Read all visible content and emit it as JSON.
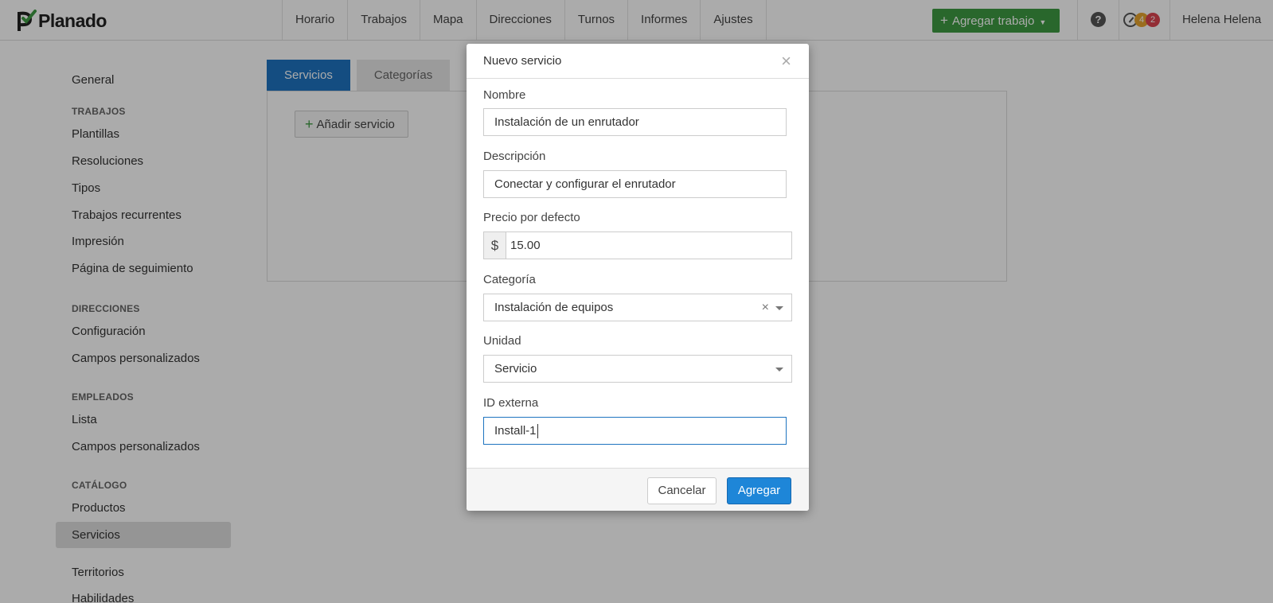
{
  "app": {
    "logo_text": "Planado",
    "nav": [
      "Horario",
      "Trabajos",
      "Mapa",
      "Direcciones",
      "Turnos",
      "Informes",
      "Ajustes"
    ],
    "add_job_label": "Agregar trabajo",
    "help_symbol": "?",
    "badge_orange": "4",
    "badge_red": "2",
    "user_name": "Helena Helena"
  },
  "sidebar": {
    "general": "General",
    "sections": [
      {
        "heading": "TRABAJOS",
        "items": [
          "Plantillas",
          "Resoluciones",
          "Tipos",
          "Trabajos recurrentes",
          "Impresión",
          "Página de seguimiento"
        ]
      },
      {
        "heading": "DIRECCIONES",
        "items": [
          "Configuración",
          "Campos personalizados"
        ]
      },
      {
        "heading": "EMPLEADOS",
        "items": [
          "Lista",
          "Campos personalizados"
        ]
      },
      {
        "heading": "CATÁLOGO",
        "items": [
          "Productos",
          "Servicios"
        ]
      }
    ],
    "extra": [
      "Territorios",
      "Habilidades"
    ],
    "active_item": "Servicios"
  },
  "content": {
    "tabs": [
      "Servicios",
      "Categorías"
    ],
    "add_service_label": "Añadir servicio"
  },
  "modal": {
    "title": "Nuevo servicio",
    "close_symbol": "×",
    "fields": {
      "name": {
        "label": "Nombre",
        "value": "Instalación de un enrutador"
      },
      "description": {
        "label": "Descripción",
        "value": "Conectar y configurar el enrutador"
      },
      "price": {
        "label": "Precio por defecto",
        "currency": "$",
        "value": "15.00"
      },
      "category": {
        "label": "Categoría",
        "value": "Instalación de equipos",
        "clear_symbol": "×"
      },
      "unit": {
        "label": "Unidad",
        "value": "Servicio"
      },
      "external_id": {
        "label": "ID externa",
        "value": "Install-1"
      }
    },
    "cancel_label": "Cancelar",
    "submit_label": "Agregar"
  }
}
